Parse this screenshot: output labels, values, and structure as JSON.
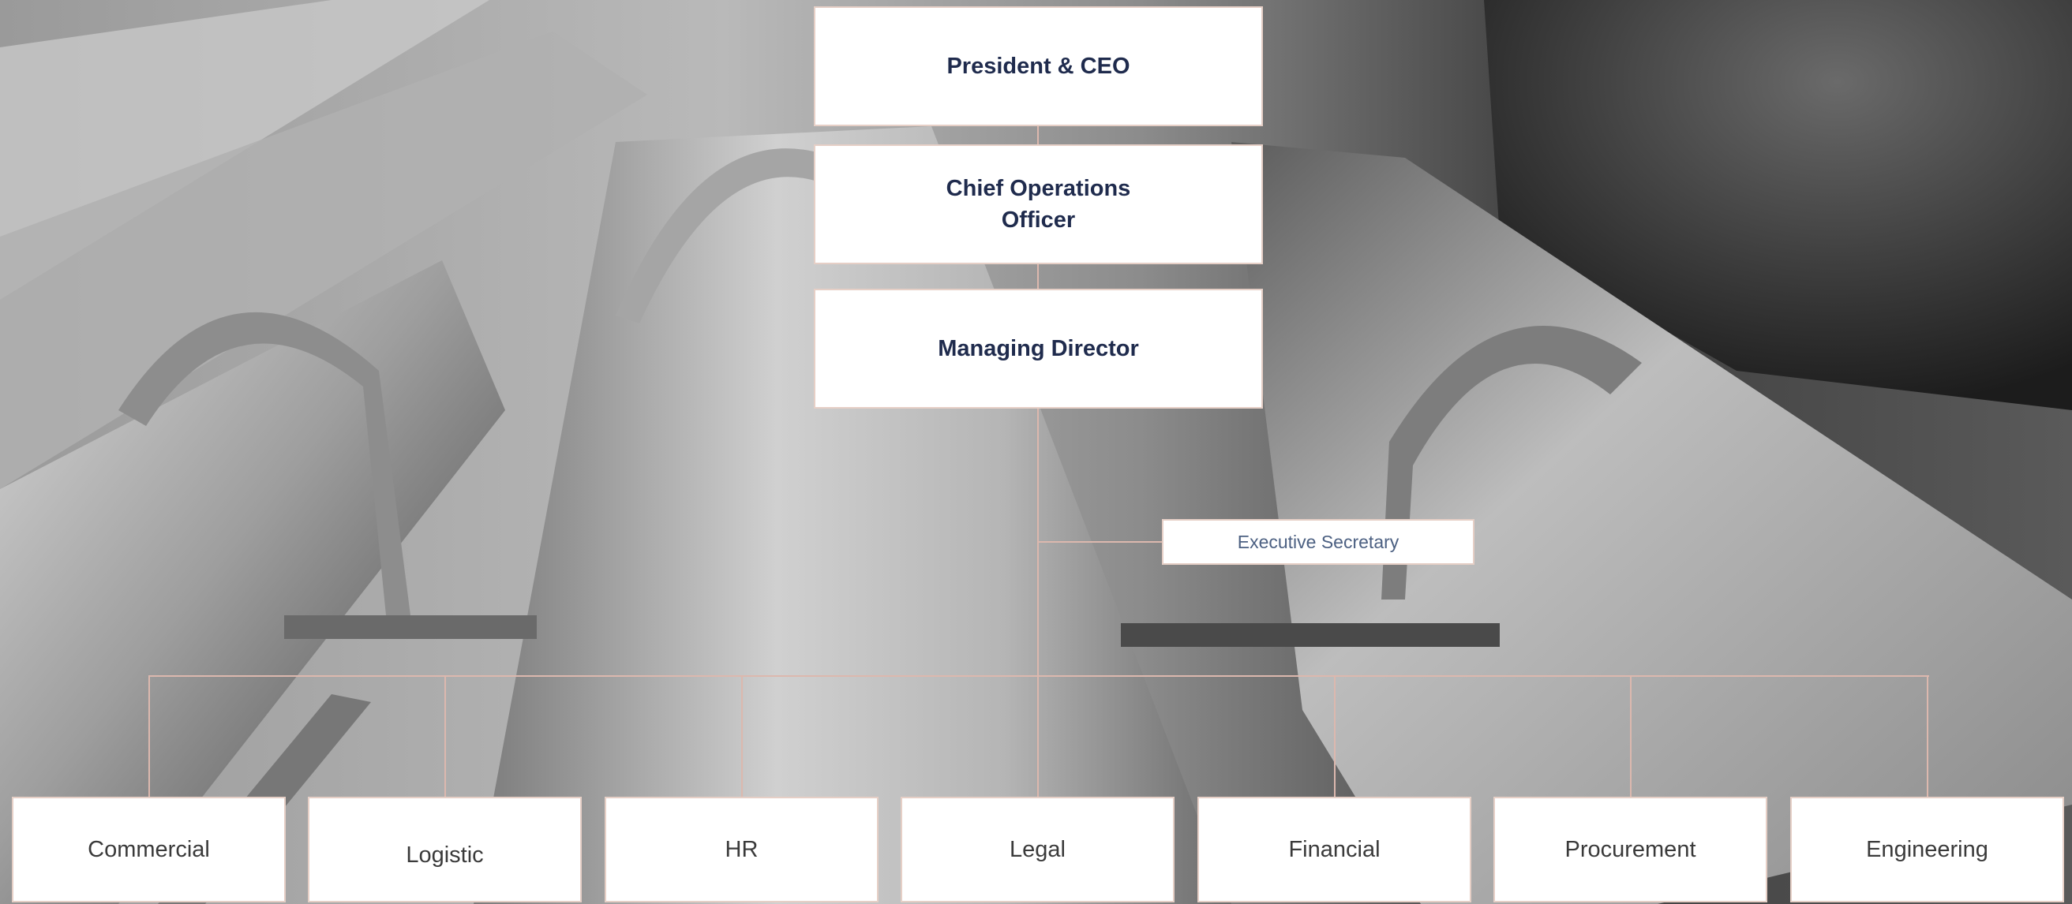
{
  "colors": {
    "box_fill": "#ffffff",
    "box_border": "#e6cfc6",
    "connector": "#dcb8ae",
    "executive_text": "#1f2b4d",
    "department_text": "#3a3a3a",
    "secretary_text": "#4c6082"
  },
  "background": {
    "description_icon": "industrial-pipes-photo"
  },
  "org_chart": {
    "president": "President & CEO",
    "coo": "Chief Operations Officer",
    "managing_director": "Managing Director",
    "executive_secretary": "Executive Secretary",
    "departments": [
      "Commercial",
      "Logistic",
      "HR",
      "Legal",
      "Financial",
      "Procurement",
      "Engineering"
    ]
  }
}
